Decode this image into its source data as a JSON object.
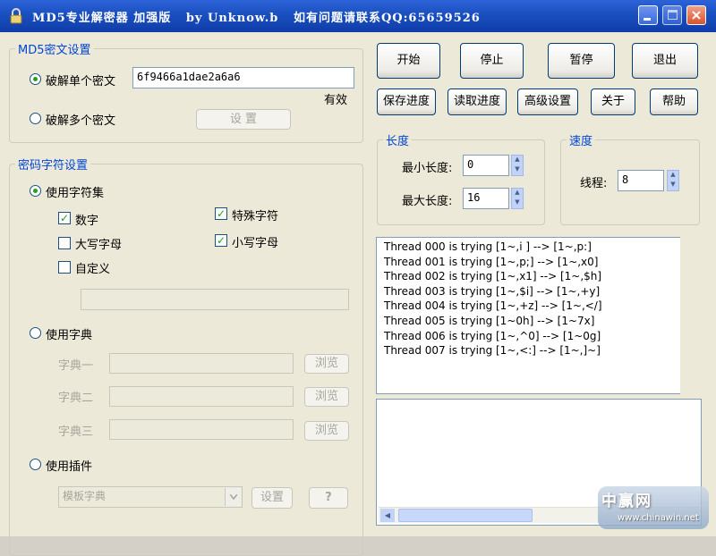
{
  "window": {
    "title": "MD5专业解密器 加强版   by Unknow.b   如有问题请联系QQ:65659526"
  },
  "md5_group": {
    "title": "MD5密文设置",
    "single_label": "破解单个密文",
    "single_value": "6f9466a1dae2a6a6",
    "valid_text": "有效",
    "multi_label": "破解多个密文",
    "settings_button": "设 置"
  },
  "charset_group": {
    "title": "密码字符设置",
    "use_charset_label": "使用字符集",
    "digits_label": "数字",
    "special_label": "特殊字符",
    "upper_label": "大写字母",
    "lower_label": "小写字母",
    "custom_label": "自定义",
    "custom_value": "",
    "use_dict_label": "使用字典",
    "dict1_label": "字典一",
    "dict2_label": "字典二",
    "dict3_label": "字典三",
    "browse_label": "浏览",
    "use_plugin_label": "使用插件",
    "plugin_selected": "模板字典",
    "plugin_settings_button": "设置",
    "plugin_help_button": "?"
  },
  "toolbar": {
    "start": "开始",
    "stop": "停止",
    "pause": "暂停",
    "exit": "退出",
    "save_progress": "保存进度",
    "load_progress": "读取进度",
    "advanced": "高级设置",
    "about": "关于",
    "help": "帮助"
  },
  "length_group": {
    "title": "长度",
    "min_label": "最小长度:",
    "min_value": "0",
    "max_label": "最大长度:",
    "max_value": "16"
  },
  "speed_group": {
    "title": "速度",
    "threads_label": "线程:",
    "threads_value": "8"
  },
  "log_lines": [
    "Thread 000 is trying  [1~,i ] --> [1~,p:]",
    "Thread 001 is trying  [1~,p;] --> [1~,x0]",
    "Thread 002 is trying  [1~,x1] --> [1~,$h]",
    "Thread 003 is trying  [1~,$i] --> [1~,+y]",
    "Thread 004 is trying  [1~,+z] --> [1~,</]",
    "Thread 005 is trying  [1~0h] --> [1~7x]",
    "Thread 006 is trying  [1~,^0] --> [1~0g]",
    "Thread 007 is trying  [1~,<:] --> [1~,]~]"
  ],
  "watermark": {
    "logo": "中赢网",
    "url": "www.chinawin.net"
  },
  "colors": {
    "titlebar": "#1a4fc0",
    "group_title": "#0046d5",
    "window_bg": "#ece9d8",
    "check_green": "#21a121"
  }
}
